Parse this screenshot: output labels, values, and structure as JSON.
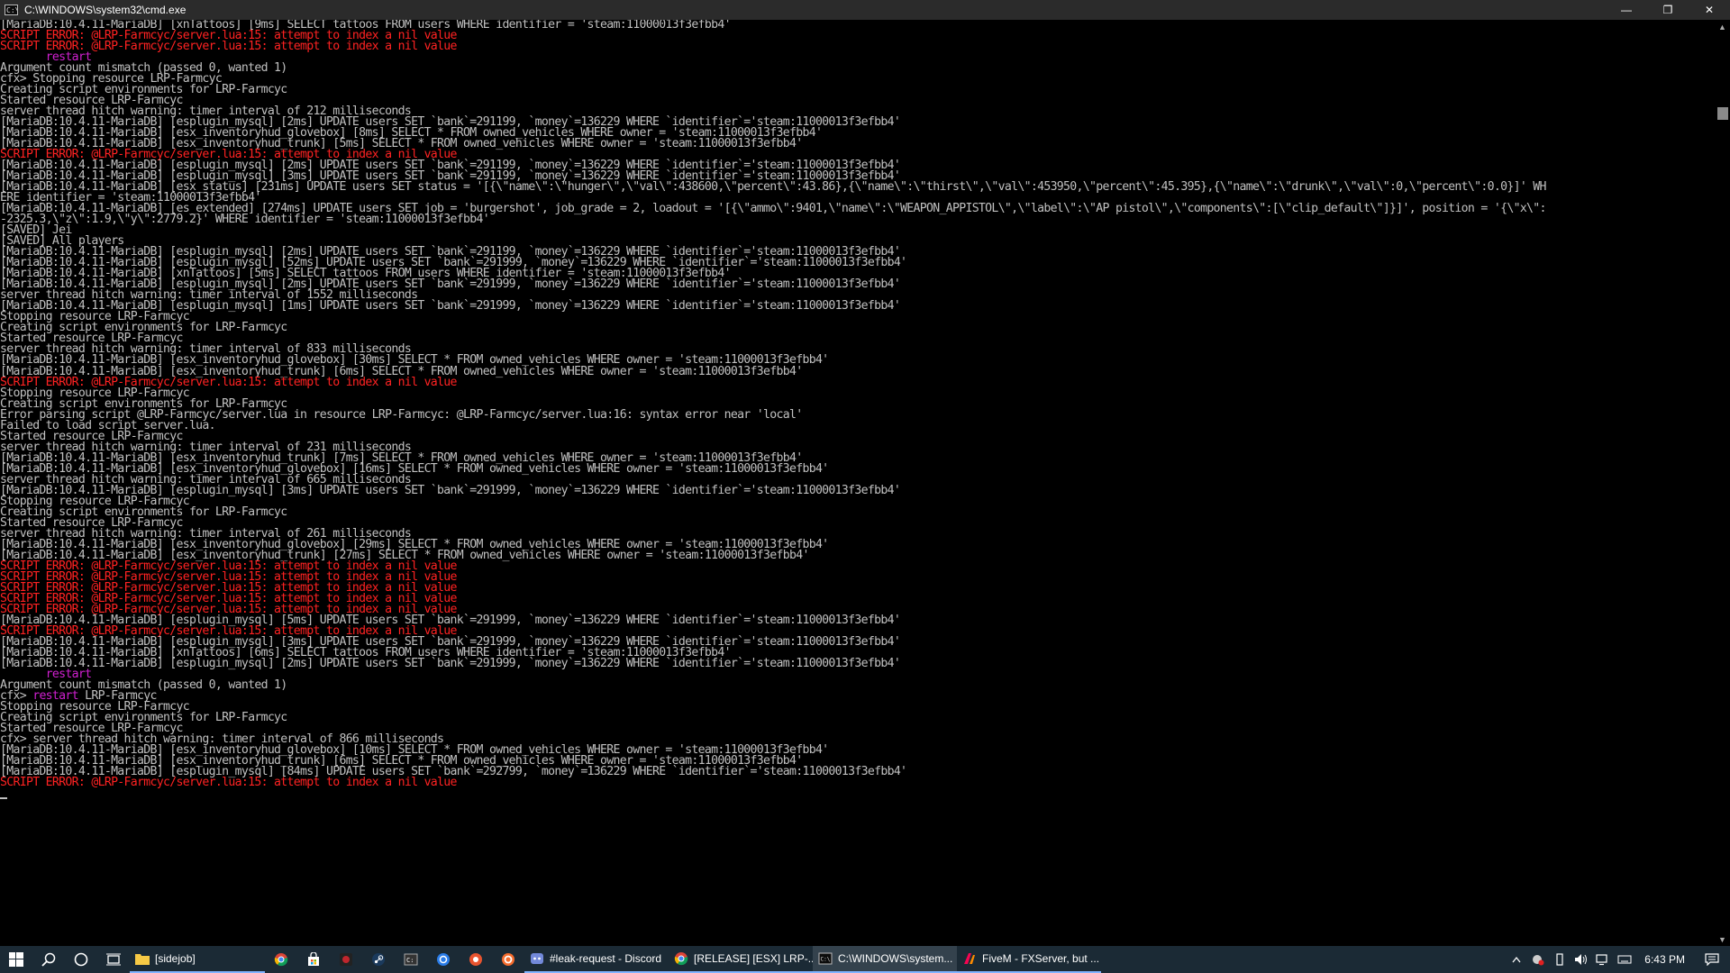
{
  "window": {
    "title": "C:\\WINDOWS\\system32\\cmd.exe",
    "minimize": "—",
    "restore": "❐",
    "close": "✕"
  },
  "console": {
    "lines": [
      {
        "t": "[MariaDB:10.4.11-MariaDB] [xnTattoos] [9ms] SELECT tattoos FROM users WHERE identifier = 'steam:11000013f3efbb4'",
        "c": "n"
      },
      {
        "t": "SCRIPT ERROR: @LRP-Farmcyc/server.lua:15: attempt to index a nil value",
        "c": "e"
      },
      {
        "t": "SCRIPT ERROR: @LRP-Farmcyc/server.lua:15: attempt to index a nil value",
        "c": "e"
      },
      {
        "t": "       restart",
        "c": "m"
      },
      {
        "t": "Argument count mismatch (passed 0, wanted 1)",
        "c": "n"
      },
      {
        "t": "cfx> Stopping resource LRP-Farmcyc",
        "c": "n"
      },
      {
        "t": "Creating script environments for LRP-Farmcyc",
        "c": "n"
      },
      {
        "t": "Started resource LRP-Farmcyc",
        "c": "n"
      },
      {
        "t": "server thread hitch warning: timer interval of 212 milliseconds",
        "c": "n"
      },
      {
        "t": "[MariaDB:10.4.11-MariaDB] [esplugin_mysql] [2ms] UPDATE users SET `bank`=291199, `money`=136229 WHERE `identifier`='steam:11000013f3efbb4'",
        "c": "n"
      },
      {
        "t": "[MariaDB:10.4.11-MariaDB] [esx_inventoryhud_glovebox] [8ms] SELECT * FROM owned_vehicles WHERE owner = 'steam:11000013f3efbb4'",
        "c": "n"
      },
      {
        "t": "[MariaDB:10.4.11-MariaDB] [esx_inventoryhud_trunk] [5ms] SELECT * FROM owned_vehicles WHERE owner = 'steam:11000013f3efbb4'",
        "c": "n"
      },
      {
        "t": "SCRIPT ERROR: @LRP-Farmcyc/server.lua:15: attempt to index a nil value",
        "c": "e"
      },
      {
        "t": "[MariaDB:10.4.11-MariaDB] [esplugin_mysql] [2ms] UPDATE users SET `bank`=291199, `money`=136229 WHERE `identifier`='steam:11000013f3efbb4'",
        "c": "n"
      },
      {
        "t": "[MariaDB:10.4.11-MariaDB] [esplugin_mysql] [3ms] UPDATE users SET `bank`=291199, `money`=136229 WHERE `identifier`='steam:11000013f3efbb4'",
        "c": "n"
      },
      {
        "t": "[MariaDB:10.4.11-MariaDB] [esx_status] [231ms] UPDATE users SET status = '[{\\\"name\\\":\\\"hunger\\\",\\\"val\\\":438600,\\\"percent\\\":43.86},{\\\"name\\\":\\\"thirst\\\",\\\"val\\\":453950,\\\"percent\\\":45.395},{\\\"name\\\":\\\"drunk\\\",\\\"val\\\":0,\\\"percent\\\":0.0}]' WH",
        "c": "n"
      },
      {
        "t": "ERE identifier = 'steam:11000013f3efbb4'",
        "c": "n"
      },
      {
        "t": "[MariaDB:10.4.11-MariaDB] [es_extended] [274ms] UPDATE users SET job = 'burgershot', job_grade = 2, loadout = '[{\\\"ammo\\\":9401,\\\"name\\\":\\\"WEAPON_APPISTOL\\\",\\\"label\\\":\\\"AP pistol\\\",\\\"components\\\":[\\\"clip_default\\\"]}]', position = '{\\\"x\\\":",
        "c": "n"
      },
      {
        "t": "-2325.3,\\\"z\\\":1.9,\\\"y\\\":2779.2}' WHERE identifier = 'steam:11000013f3efbb4'",
        "c": "n"
      },
      {
        "t": "[SAVED] Jei",
        "c": "n"
      },
      {
        "t": "[SAVED] All players",
        "c": "n"
      },
      {
        "t": "[MariaDB:10.4.11-MariaDB] [esplugin_mysql] [2ms] UPDATE users SET `bank`=291199, `money`=136229 WHERE `identifier`='steam:11000013f3efbb4'",
        "c": "n"
      },
      {
        "t": "[MariaDB:10.4.11-MariaDB] [esplugin_mysql] [52ms] UPDATE users SET `bank`=291999, `money`=136229 WHERE `identifier`='steam:11000013f3efbb4'",
        "c": "n"
      },
      {
        "t": "[MariaDB:10.4.11-MariaDB] [xnTattoos] [5ms] SELECT tattoos FROM users WHERE identifier = 'steam:11000013f3efbb4'",
        "c": "n"
      },
      {
        "t": "[MariaDB:10.4.11-MariaDB] [esplugin_mysql] [2ms] UPDATE users SET `bank`=291999, `money`=136229 WHERE `identifier`='steam:11000013f3efbb4'",
        "c": "n"
      },
      {
        "t": "server thread hitch warning: timer interval of 1552 milliseconds",
        "c": "n"
      },
      {
        "t": "[MariaDB:10.4.11-MariaDB] [esplugin_mysql] [1ms] UPDATE users SET `bank`=291999, `money`=136229 WHERE `identifier`='steam:11000013f3efbb4'",
        "c": "n"
      },
      {
        "t": "Stopping resource LRP-Farmcyc",
        "c": "n"
      },
      {
        "t": "Creating script environments for LRP-Farmcyc",
        "c": "n"
      },
      {
        "t": "Started resource LRP-Farmcyc",
        "c": "n"
      },
      {
        "t": "server thread hitch warning: timer interval of 833 milliseconds",
        "c": "n"
      },
      {
        "t": "[MariaDB:10.4.11-MariaDB] [esx_inventoryhud_glovebox] [30ms] SELECT * FROM owned_vehicles WHERE owner = 'steam:11000013f3efbb4'",
        "c": "n"
      },
      {
        "t": "[MariaDB:10.4.11-MariaDB] [esx_inventoryhud_trunk] [6ms] SELECT * FROM owned_vehicles WHERE owner = 'steam:11000013f3efbb4'",
        "c": "n"
      },
      {
        "t": "SCRIPT ERROR: @LRP-Farmcyc/server.lua:15: attempt to index a nil value",
        "c": "e"
      },
      {
        "t": "Stopping resource LRP-Farmcyc",
        "c": "n"
      },
      {
        "t": "Creating script environments for LRP-Farmcyc",
        "c": "n"
      },
      {
        "t": "Error parsing script @LRP-Farmcyc/server.lua in resource LRP-Farmcyc: @LRP-Farmcyc/server.lua:16: syntax error near 'local'",
        "c": "n"
      },
      {
        "t": "Failed to load script server.lua.",
        "c": "n"
      },
      {
        "t": "Started resource LRP-Farmcyc",
        "c": "n"
      },
      {
        "t": "server thread hitch warning: timer interval of 231 milliseconds",
        "c": "n"
      },
      {
        "t": "[MariaDB:10.4.11-MariaDB] [esx_inventoryhud_trunk] [7ms] SELECT * FROM owned_vehicles WHERE owner = 'steam:11000013f3efbb4'",
        "c": "n"
      },
      {
        "t": "[MariaDB:10.4.11-MariaDB] [esx_inventoryhud_glovebox] [16ms] SELECT * FROM owned_vehicles WHERE owner = 'steam:11000013f3efbb4'",
        "c": "n"
      },
      {
        "t": "server thread hitch warning: timer interval of 665 milliseconds",
        "c": "n"
      },
      {
        "t": "[MariaDB:10.4.11-MariaDB] [esplugin_mysql] [3ms] UPDATE users SET `bank`=291999, `money`=136229 WHERE `identifier`='steam:11000013f3efbb4'",
        "c": "n"
      },
      {
        "t": "Stopping resource LRP-Farmcyc",
        "c": "n"
      },
      {
        "t": "Creating script environments for LRP-Farmcyc",
        "c": "n"
      },
      {
        "t": "Started resource LRP-Farmcyc",
        "c": "n"
      },
      {
        "t": "server thread hitch warning: timer interval of 261 milliseconds",
        "c": "n"
      },
      {
        "t": "[MariaDB:10.4.11-MariaDB] [esx_inventoryhud_glovebox] [29ms] SELECT * FROM owned_vehicles WHERE owner = 'steam:11000013f3efbb4'",
        "c": "n"
      },
      {
        "t": "[MariaDB:10.4.11-MariaDB] [esx_inventoryhud_trunk] [27ms] SELECT * FROM owned_vehicles WHERE owner = 'steam:11000013f3efbb4'",
        "c": "n"
      },
      {
        "t": "SCRIPT ERROR: @LRP-Farmcyc/server.lua:15: attempt to index a nil value",
        "c": "e"
      },
      {
        "t": "SCRIPT ERROR: @LRP-Farmcyc/server.lua:15: attempt to index a nil value",
        "c": "e"
      },
      {
        "t": "SCRIPT ERROR: @LRP-Farmcyc/server.lua:15: attempt to index a nil value",
        "c": "e"
      },
      {
        "t": "SCRIPT ERROR: @LRP-Farmcyc/server.lua:15: attempt to index a nil value",
        "c": "e"
      },
      {
        "t": "SCRIPT ERROR: @LRP-Farmcyc/server.lua:15: attempt to index a nil value",
        "c": "e"
      },
      {
        "t": "[MariaDB:10.4.11-MariaDB] [esplugin_mysql] [5ms] UPDATE users SET `bank`=291999, `money`=136229 WHERE `identifier`='steam:11000013f3efbb4'",
        "c": "n"
      },
      {
        "t": "SCRIPT ERROR: @LRP-Farmcyc/server.lua:15: attempt to index a nil value",
        "c": "e"
      },
      {
        "t": "[MariaDB:10.4.11-MariaDB] [esplugin_mysql] [3ms] UPDATE users SET `bank`=291999, `money`=136229 WHERE `identifier`='steam:11000013f3efbb4'",
        "c": "n"
      },
      {
        "t": "[MariaDB:10.4.11-MariaDB] [xnTattoos] [6ms] SELECT tattoos FROM users WHERE identifier = 'steam:11000013f3efbb4'",
        "c": "n"
      },
      {
        "t": "[MariaDB:10.4.11-MariaDB] [esplugin_mysql] [2ms] UPDATE users SET `bank`=291999, `money`=136229 WHERE `identifier`='steam:11000013f3efbb4'",
        "c": "n"
      },
      {
        "t": "       restart",
        "c": "m"
      },
      {
        "t": "Argument count mismatch (passed 0, wanted 1)",
        "c": "n"
      },
      {
        "t": "cfx> |restart| LRP-Farmcyc",
        "c": "r"
      },
      {
        "t": "Stopping resource LRP-Farmcyc",
        "c": "n"
      },
      {
        "t": "Creating script environments for LRP-Farmcyc",
        "c": "n"
      },
      {
        "t": "Started resource LRP-Farmcyc",
        "c": "n"
      },
      {
        "t": "cfx> server thread hitch warning: timer interval of 866 milliseconds",
        "c": "n"
      },
      {
        "t": "[MariaDB:10.4.11-MariaDB] [esx_inventoryhud_glovebox] [10ms] SELECT * FROM owned_vehicles WHERE owner = 'steam:11000013f3efbb4'",
        "c": "n"
      },
      {
        "t": "[MariaDB:10.4.11-MariaDB] [esx_inventoryhud_trunk] [6ms] SELECT * FROM owned_vehicles WHERE owner = 'steam:11000013f3efbb4'",
        "c": "n"
      },
      {
        "t": "[MariaDB:10.4.11-MariaDB] [esplugin_mysql] [84ms] UPDATE users SET `bank`=292799, `money`=136229 WHERE `identifier`='steam:11000013f3efbb4'",
        "c": "n"
      },
      {
        "t": "SCRIPT ERROR: @LRP-Farmcyc/server.lua:15: attempt to index a nil value",
        "c": "e"
      }
    ]
  },
  "taskbar": {
    "start_icon": "windows-logo-icon",
    "search_icon": "search-icon",
    "cortana_icon": "cortana-circle-icon",
    "taskview_icon": "task-view-icon",
    "folder_label": "[sidejob]",
    "apps": [
      {
        "label": "#leak-request - Discord",
        "icon": "discord-icon"
      },
      {
        "label": "[RELEASE] [ESX] LRP-...",
        "icon": "chrome-icon"
      },
      {
        "label": "C:\\WINDOWS\\system...",
        "icon": "cmd-icon"
      },
      {
        "label": "FiveM - FXServer, but ...",
        "icon": "fivem-icon"
      }
    ],
    "clock": "6:43 PM"
  }
}
